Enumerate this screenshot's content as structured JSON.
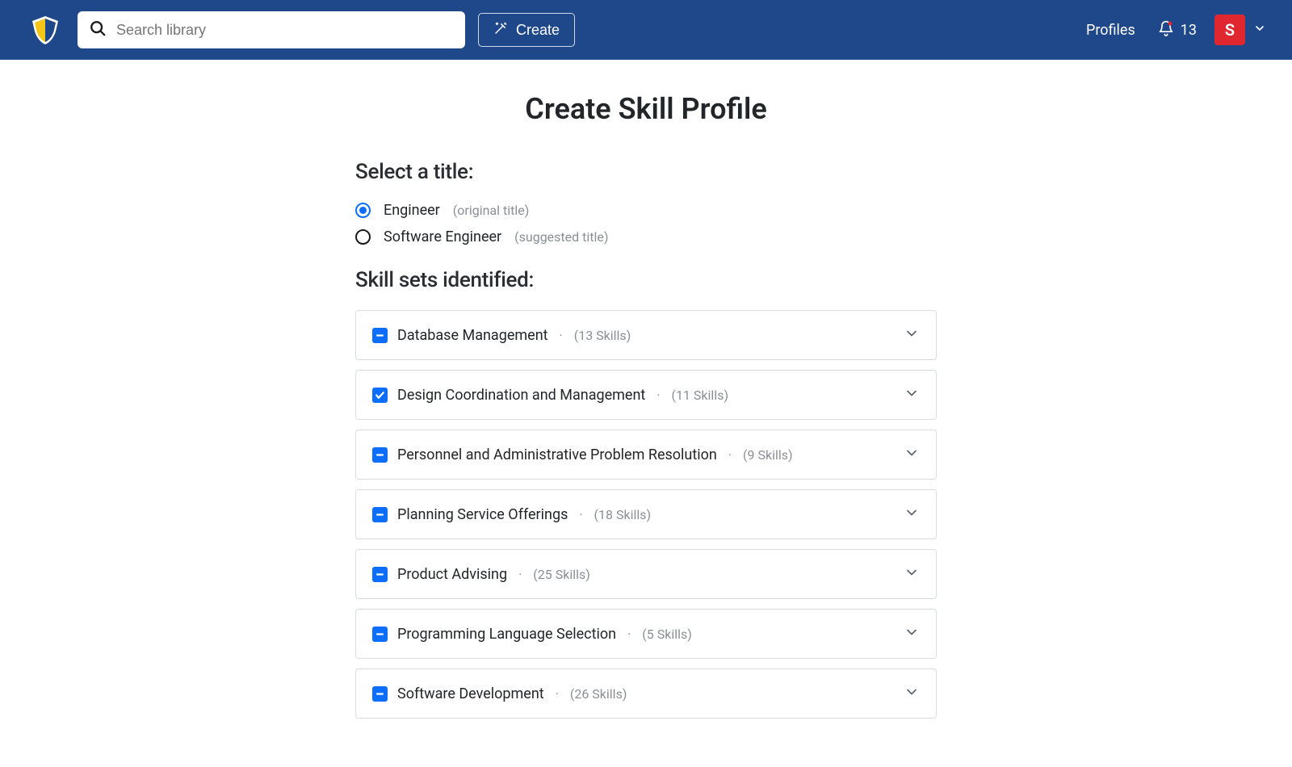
{
  "header": {
    "search_placeholder": "Search library",
    "create_label": "Create",
    "profiles_label": "Profiles",
    "notifications_count": "13",
    "avatar_letter": "S"
  },
  "page": {
    "title": "Create Skill Profile",
    "select_title_heading": "Select a title:",
    "skill_sets_heading": "Skill sets identified:"
  },
  "title_options": [
    {
      "label": "Engineer",
      "note": "(original title)",
      "selected": true
    },
    {
      "label": "Software Engineer",
      "note": "(suggested title)",
      "selected": false
    }
  ],
  "skill_sets": [
    {
      "name": "Database Management",
      "count": "(13 Skills)",
      "state": "indeterminate"
    },
    {
      "name": "Design Coordination and Management",
      "count": "(11 Skills)",
      "state": "checked"
    },
    {
      "name": "Personnel and Administrative Problem Resolution",
      "count": "(9 Skills)",
      "state": "indeterminate"
    },
    {
      "name": "Planning Service Offerings",
      "count": "(18 Skills)",
      "state": "indeterminate"
    },
    {
      "name": "Product Advising",
      "count": "(25 Skills)",
      "state": "indeterminate"
    },
    {
      "name": "Programming Language Selection",
      "count": "(5 Skills)",
      "state": "indeterminate"
    },
    {
      "name": "Software Development",
      "count": "(26 Skills)",
      "state": "indeterminate"
    }
  ]
}
